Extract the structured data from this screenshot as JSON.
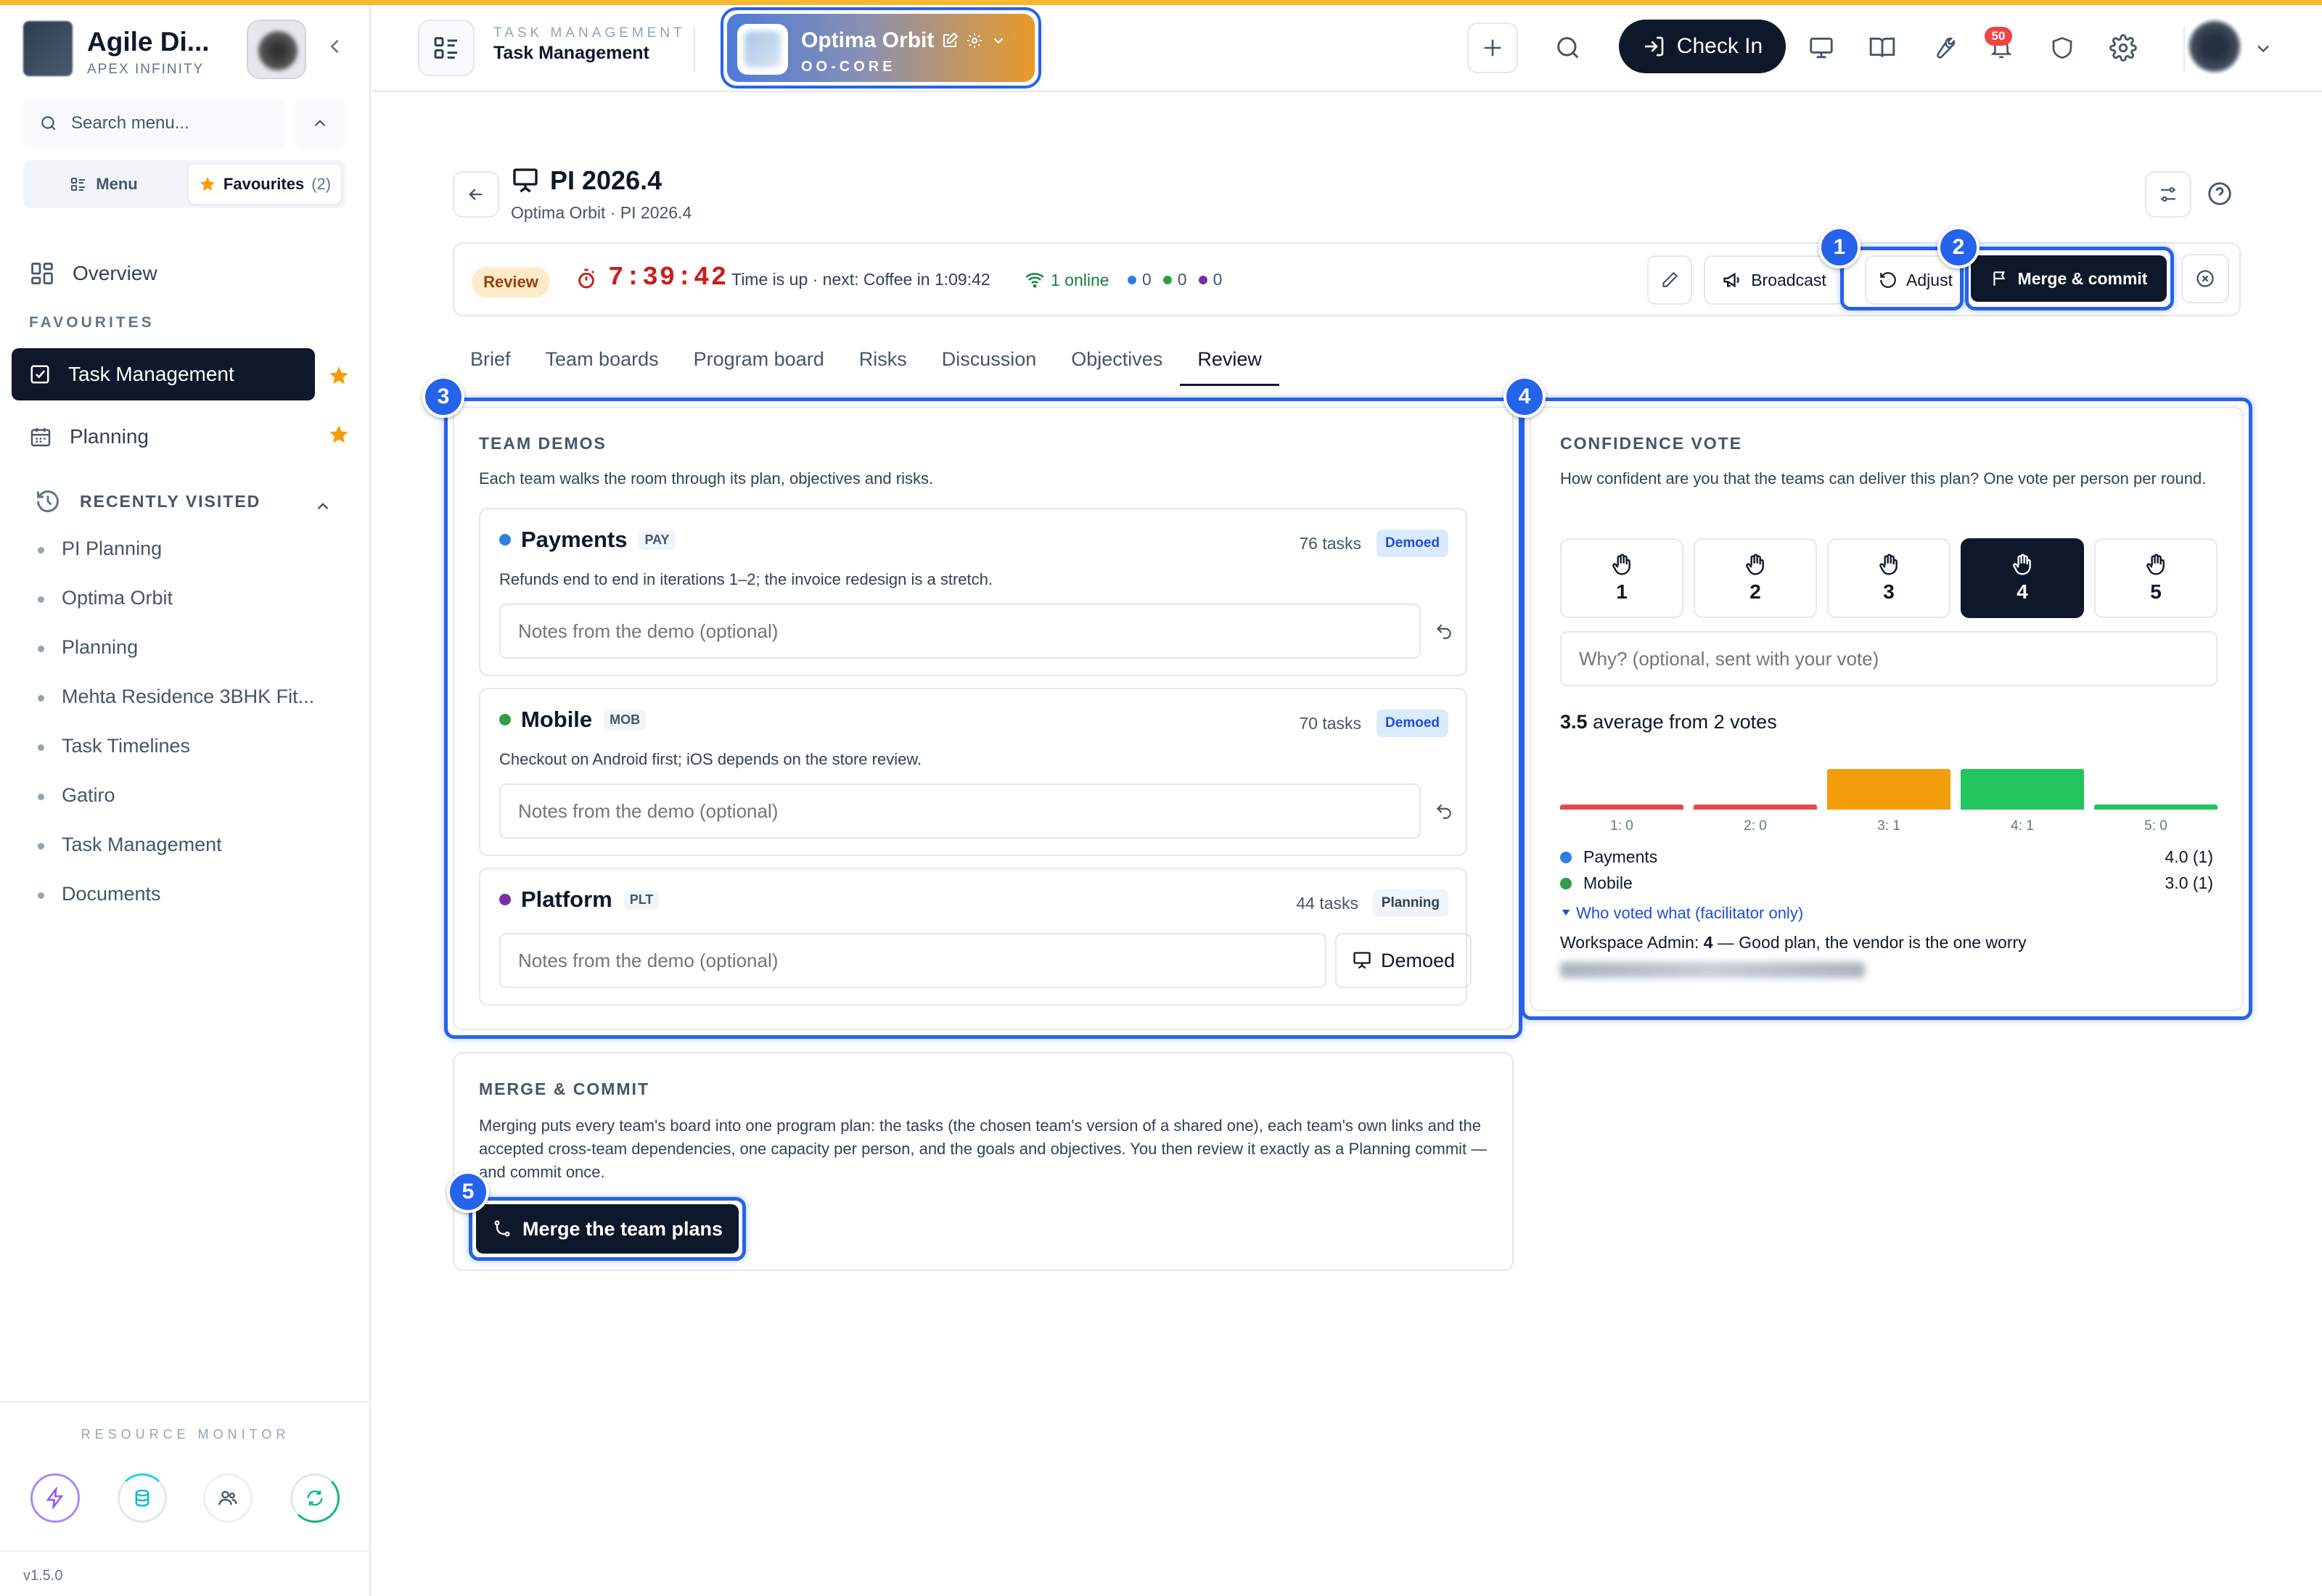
{
  "sidebar": {
    "brand_name": "Agile Di...",
    "brand_sub": "APEX INFINITY",
    "search_placeholder": "Search menu...",
    "seg_menu": "Menu",
    "seg_fav": "Favourites",
    "seg_fav_count": "(2)",
    "overview": "Overview",
    "favourites_heading": "FAVOURITES",
    "favourites": [
      "Task Management",
      "Planning"
    ],
    "recent_heading": "RECENTLY VISITED",
    "recent": [
      "PI Planning",
      "Optima Orbit",
      "Planning",
      "Mehta Residence 3BHK Fit...",
      "Task Timelines",
      "Gatiro",
      "Task Management",
      "Documents"
    ],
    "resource_label": "RESOURCE MONITOR",
    "version": "v1.5.0"
  },
  "header": {
    "over": "TASK MANAGEMENT",
    "title": "Task Management",
    "project_name": "Optima Orbit",
    "project_code": "OO-CORE",
    "checkin": "Check In",
    "notif_count": "50"
  },
  "page": {
    "title": "PI 2026.4",
    "subtitle": "Optima Orbit · PI 2026.4"
  },
  "status": {
    "phase": "Review",
    "timer": "7:39:42",
    "time_msg": "Time is up · next: Coffee in 1:09:42",
    "online": "1 online",
    "counts": [
      "0",
      "0",
      "0"
    ],
    "broadcast": "Broadcast",
    "adjust": "Adjust",
    "merge_commit": "Merge & commit"
  },
  "colors": {
    "blue": "#2d7fe0",
    "green": "#2f9d4a",
    "purple": "#7b2fa3",
    "highlight": "#2563eb"
  },
  "tabs": [
    "Brief",
    "Team boards",
    "Program board",
    "Risks",
    "Discussion",
    "Objectives",
    "Review"
  ],
  "active_tab": "Review",
  "callouts": [
    "1",
    "2",
    "3",
    "4",
    "5"
  ],
  "team_demos": {
    "heading": "TEAM DEMOS",
    "desc": "Each team walks the room through its plan, objectives and risks.",
    "notes_placeholder": "Notes from the demo (optional)",
    "teams": [
      {
        "name": "Payments",
        "code": "PAY",
        "tasks": "76 tasks",
        "status": "Demoed",
        "desc": "Refunds end to end in iterations 1–2; the invoice redesign is a stretch."
      },
      {
        "name": "Mobile",
        "code": "MOB",
        "tasks": "70 tasks",
        "status": "Demoed",
        "desc": "Checkout on Android first; iOS depends on the store review."
      },
      {
        "name": "Platform",
        "code": "PLT",
        "tasks": "44 tasks",
        "status": "Planning",
        "button": "Demoed"
      }
    ]
  },
  "confidence": {
    "heading": "CONFIDENCE VOTE",
    "desc": "How confident are you that the teams can deliver this plan? One vote per person per round.",
    "options": [
      "1",
      "2",
      "3",
      "4",
      "5"
    ],
    "selected": "4",
    "why_placeholder": "Why? (optional, sent with your vote)",
    "avg_value": "3.5",
    "avg_text": "average from 2 votes",
    "distribution": [
      {
        "label": "1: 0",
        "count": 0,
        "color": "#e5484d"
      },
      {
        "label": "2: 0",
        "count": 0,
        "color": "#e5484d"
      },
      {
        "label": "3: 1",
        "count": 1,
        "color": "#f59e0b"
      },
      {
        "label": "4: 1",
        "count": 1,
        "color": "#22c55e"
      },
      {
        "label": "5: 0",
        "count": 0,
        "color": "#22c55e"
      }
    ],
    "legend": [
      {
        "name": "Payments",
        "value": "4.0 (1)"
      },
      {
        "name": "Mobile",
        "value": "3.0 (1)"
      }
    ],
    "who_voted": "Who voted what (facilitator only)",
    "voter_name": "Workspace Admin:",
    "voter_score": "4",
    "voter_comment": "— Good plan, the vendor is the one worry"
  },
  "merge": {
    "heading": "MERGE & COMMIT",
    "desc": "Merging puts every team's board into one program plan: the tasks (the chosen team's version of a shared one), each team's own links and the accepted cross-team dependencies, one capacity per person, and the goals and objectives. You then review it exactly as a Planning commit — and commit once.",
    "button": "Merge the team plans"
  }
}
